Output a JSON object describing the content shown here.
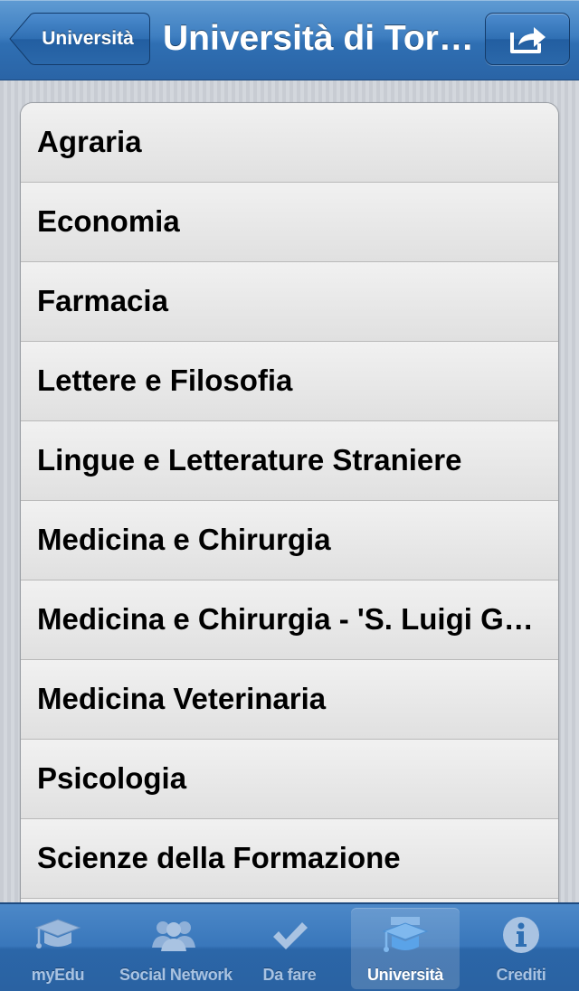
{
  "navbar": {
    "back_label": "Università",
    "title": "Università di Torino",
    "share_icon": "share-icon"
  },
  "faculties": [
    "Agraria",
    "Economia",
    "Farmacia",
    "Lettere e Filosofia",
    "Lingue e Letterature Straniere",
    "Medicina e Chirurgia",
    "Medicina e Chirurgia - 'S. Luigi Gonzaga'",
    "Medicina Veterinaria",
    "Psicologia",
    "Scienze della Formazione"
  ],
  "tabbar": {
    "tabs": [
      {
        "label": "myEdu",
        "icon": "graduation-cap-icon",
        "selected": false
      },
      {
        "label": "Social Network",
        "icon": "people-icon",
        "selected": false
      },
      {
        "label": "Da fare",
        "icon": "checkmark-icon",
        "selected": false
      },
      {
        "label": "Università",
        "icon": "university-cap-icon",
        "selected": true
      },
      {
        "label": "Crediti",
        "icon": "info-icon",
        "selected": false
      }
    ]
  },
  "colors": {
    "nav_blue": "#3f7fc1",
    "tab_inactive_text": "#a9c3e2",
    "tab_active_text": "#ffffff"
  }
}
